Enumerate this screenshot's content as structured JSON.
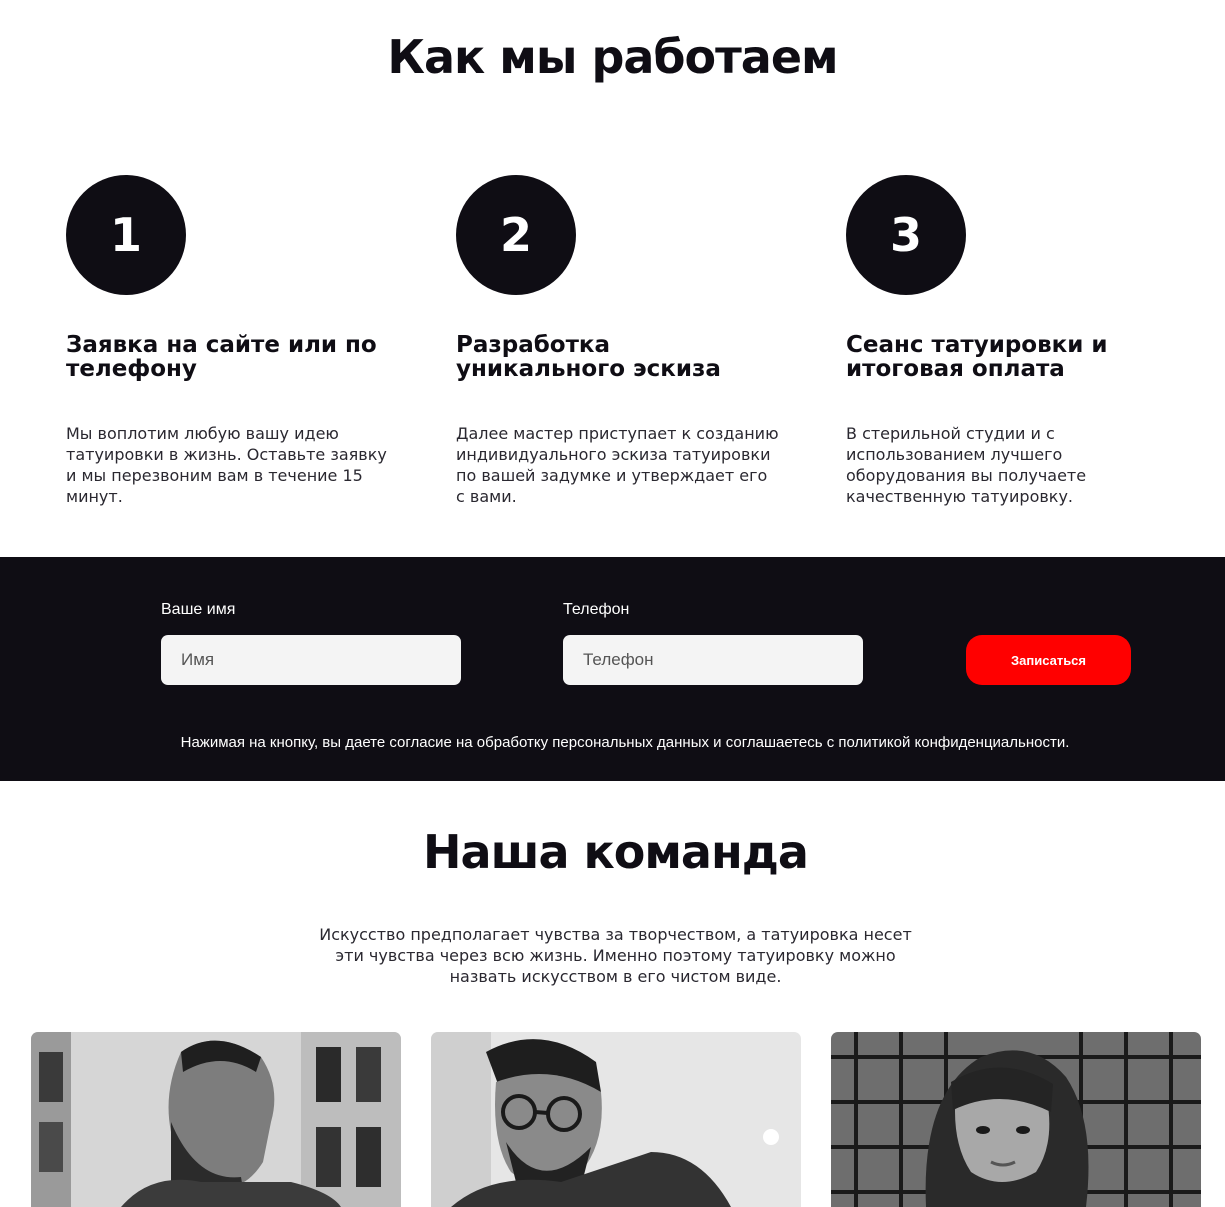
{
  "how": {
    "title": "Как мы работаем",
    "steps": [
      {
        "number": "1",
        "title": "Заявка на сайте или по телефону",
        "text": "Мы воплотим любую вашу идею татуировки в жизнь. Оставьте заявку и мы перезвоним вам в течение 15 минут."
      },
      {
        "number": "2",
        "title": "Разработка уникального эскиза",
        "text": "Далее мастер приступает к созданию индивидуального эскиза татуировки по вашей задумке и утверждает его с вами."
      },
      {
        "number": "3",
        "title": "Сеанс татуировки и итоговая оплата",
        "text": "В стерильной студии и с использованием лучшего оборудования вы получаете качественную татуировку."
      }
    ]
  },
  "form": {
    "name_label": "Ваше имя",
    "name_placeholder": "Имя",
    "phone_label": "Телефон",
    "phone_placeholder": "Телефон",
    "submit_label": "Записаться",
    "consent": "Нажимая на кнопку, вы даете согласие на обработку персональных данных и соглашаетесь с политикой конфиденциальности."
  },
  "team": {
    "title": "Наша команда",
    "text": "Искусство предполагает чувства за творчеством, а татуировка несет эти чувства через всю жизнь. Именно поэтому татуировку можно назвать искусством в его чистом виде."
  },
  "colors": {
    "dark": "#0f0d14",
    "accent": "#ff0000",
    "input_bg": "#f4f4f4"
  }
}
